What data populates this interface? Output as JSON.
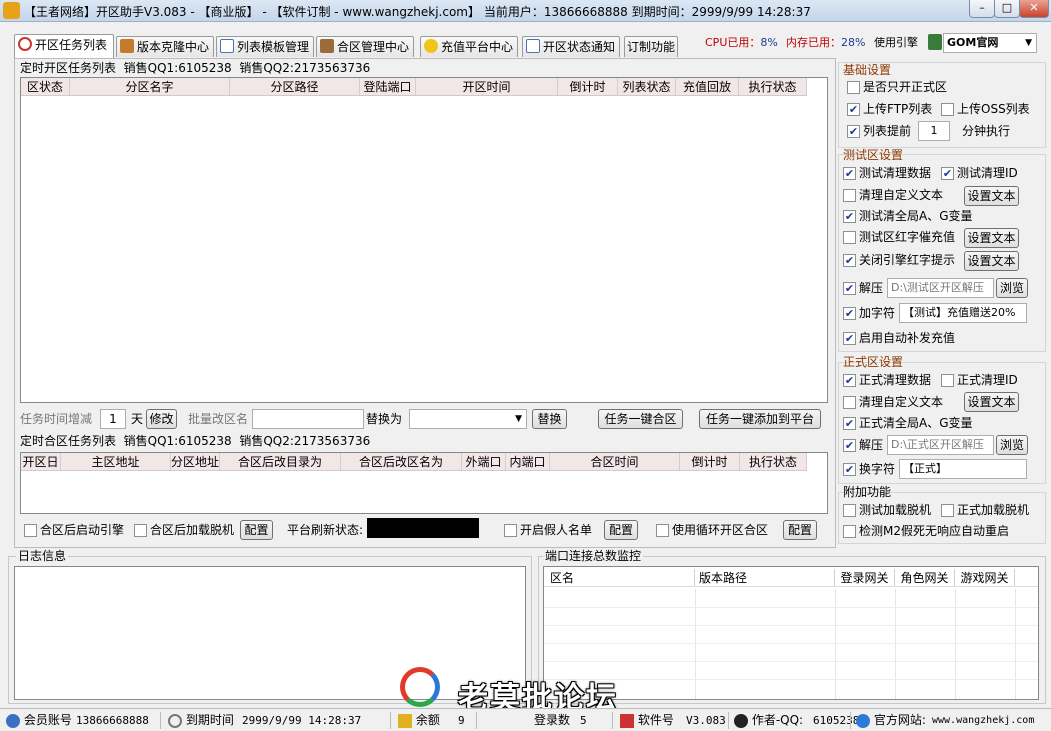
{
  "window": {
    "title": "【王者网络】开区助手V3.083 - 【商业版】 - 【软件订制 - www.wangzhekj.com】 当前用户：13866668888  到期时间：2999/9/99 14:28:37"
  },
  "tabs": [
    {
      "label": "开区任务列表",
      "icon": "clock-icon",
      "active": true
    },
    {
      "label": "版本克隆中心",
      "icon": "book-icon"
    },
    {
      "label": "列表模板管理",
      "icon": "list-icon"
    },
    {
      "label": "合区管理中心",
      "icon": "server-icon"
    },
    {
      "label": "充值平台中心",
      "icon": "coin-icon"
    },
    {
      "label": "开区状态通知",
      "icon": "doc-icon"
    },
    {
      "label": "订制功能",
      "icon": ""
    }
  ],
  "top_status": {
    "cpu_label": "CPU已用：",
    "cpu_value": "8%",
    "mem_label": "内存已用：",
    "mem_value": "28%",
    "engine_label": "使用引擎",
    "engine_value": "GOM官网"
  },
  "open_tasks": {
    "title": "定时开区任务列表",
    "qq1": "销售QQ1:6105238",
    "qq2": "销售QQ2:2173563736",
    "columns": [
      "区状态",
      "分区名字",
      "分区路径",
      "登陆端口",
      "开区时间",
      "倒计时",
      "列表状态",
      "充值回放",
      "执行状态"
    ],
    "interval_label": "任务时间增减",
    "interval_value": "1",
    "day_label": "天",
    "modify_btn": "修改",
    "batch_label": "批量改区名",
    "replace_label": "替换为",
    "replace_btn": "替换",
    "merge_btn": "任务一键合区",
    "add_platform_btn": "任务一键添加到平台"
  },
  "merge_tasks": {
    "title": "定时合区任务列表",
    "qq1": "销售QQ1:6105238",
    "qq2": "销售QQ2:2173563736",
    "columns": [
      "开区日",
      "主区地址",
      "分区地址",
      "合区后改目录为",
      "合区后改区名为",
      "外端口",
      "内端口",
      "合区时间",
      "倒计时",
      "执行状态"
    ],
    "opt_start_engine": "合区后启动引擎",
    "opt_load_offline": "合区后加载脱机",
    "config_btn": "配置",
    "refresh_label": "平台刷新状态:",
    "opt_fake_list": "开启假人名单",
    "config_btn2": "配置",
    "opt_loop_merge": "使用循环开区合区",
    "config_btn3": "配置"
  },
  "settings": {
    "basic_title": "基础设置",
    "only_official": "是否只开正式区",
    "upload_ftp": "上传FTP列表",
    "upload_oss": "上传OSS列表",
    "list_ahead": "列表提前",
    "list_ahead_value": "1",
    "list_ahead_unit": "分钟执行",
    "test_title": "测试区设置",
    "test_clear_data": "测试清理数据",
    "test_clear_id": "测试清理ID",
    "clear_custom_text": "清理自定义文本",
    "set_text": "设置文本",
    "test_clear_global": "测试清全局A、G变量",
    "test_red_recharge": "测试区红字催充值",
    "close_engine_red": "关闭引擎红字提示",
    "unzip": "解压",
    "test_unzip_path": "D:\\测试区开区解压",
    "browse": "浏览",
    "add_symbol": "加字符",
    "test_symbol_value": "【测试】充值赠送20%",
    "auto_recharge": "启用自动补发充值",
    "official_title": "正式区设置",
    "official_clear_data": "正式清理数据",
    "official_clear_id": "正式清理ID",
    "official_clear_custom": "清理自定义文本",
    "official_clear_global": "正式清全局A、G变量",
    "official_unzip_path": "D:\\正式区开区解压",
    "replace_symbol": "换字符",
    "official_symbol_value": "【正式】",
    "extra_title": "附加功能",
    "test_load_offline": "测试加载脱机",
    "official_load_offline": "正式加载脱机",
    "detect_m2": "检测M2假死无响应自动重启"
  },
  "log": {
    "title": "日志信息"
  },
  "port_monitor": {
    "title": "端口连接总数监控",
    "columns": [
      "区名",
      "版本路径",
      "登录网关",
      "角色网关",
      "游戏网关"
    ]
  },
  "statusbar": {
    "account_label": "会员账号",
    "account_value": "13866668888",
    "expire_label": "到期时间",
    "expire_value": "2999/9/99 14:28:37",
    "balance_label": "余额",
    "balance_value": "9",
    "login_label": "登录数",
    "login_value": "5",
    "version_label": "软件号",
    "version_value": "V3.083",
    "author_label": "作者-QQ:",
    "author_value": "6105238",
    "site_label": "官方网站:",
    "site_value": "www.wangzhekj.com"
  },
  "watermark": {
    "text": "老莫批论坛"
  },
  "colors": {
    "accent_blue": "#1f3a93",
    "section_title": "#8b3a00",
    "header_pink": "#f3e6e6"
  }
}
